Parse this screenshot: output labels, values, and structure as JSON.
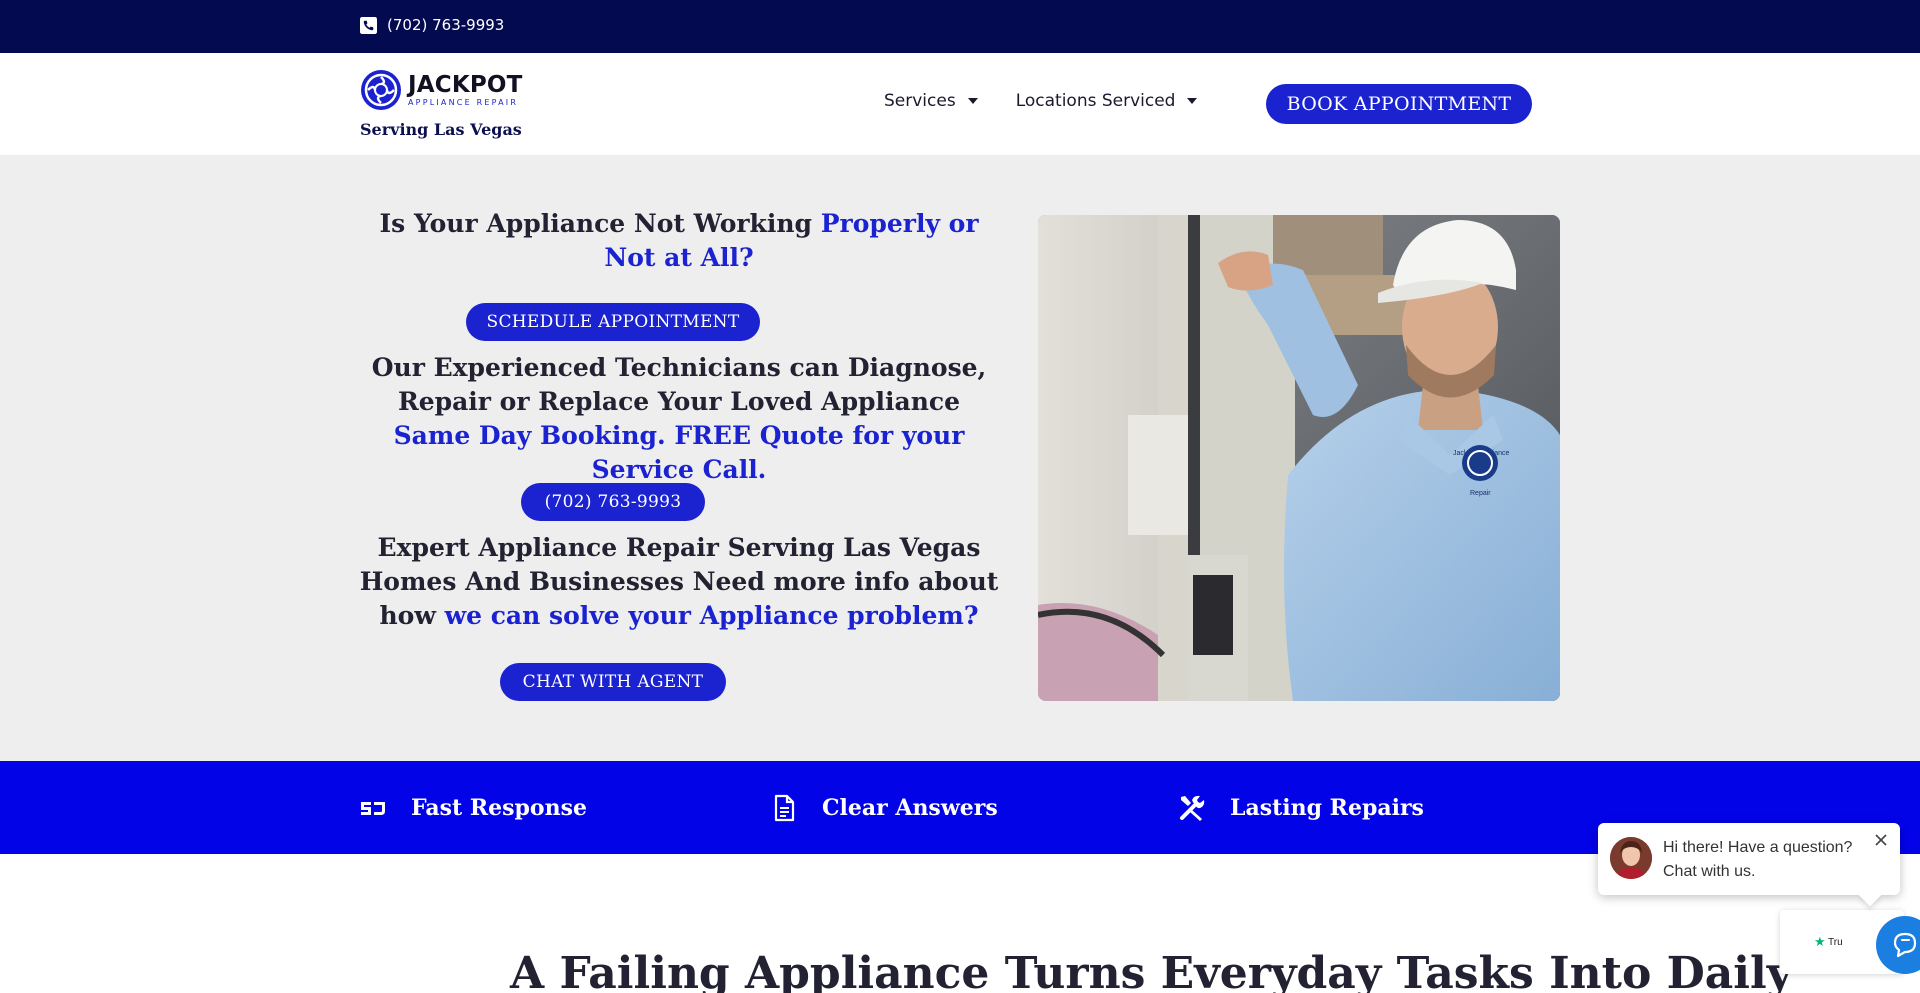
{
  "topbar": {
    "phone": "(702) 763-9993",
    "icon": "phone-square-icon"
  },
  "header": {
    "logo": {
      "brand": "JACKPOT",
      "sub": "APPLIANCE REPAIR",
      "icon": "jackpot-logo-icon"
    },
    "serving": "Serving Las Vegas",
    "nav": [
      {
        "label": "Services",
        "icon": "caret-down-icon"
      },
      {
        "label": "Locations Serviced",
        "icon": "caret-down-icon"
      }
    ],
    "book_button": "BOOK APPOINTMENT"
  },
  "hero": {
    "heading1": {
      "plain": "Is Your Appliance Not Working ",
      "highlight": "Properly or Not at All?"
    },
    "schedule_button": "SCHEDULE APPOINTMENT",
    "heading2": {
      "plain": "Our Experienced Technicians can Diagnose, Repair or Replace Your Loved Appliance ",
      "highlight": "Same Day Booking. FREE Quote for your Service Call."
    },
    "phone_button": "(702) 763-9993",
    "heading3": {
      "plain": "Expert Appliance Repair Serving Las Vegas Homes And Businesses Need more info about how ",
      "highlight": "we can solve your Appliance problem?"
    },
    "chat_button": "CHAT WITH AGENT",
    "photo_text": {
      "shirt_line1": "Jackpot Appliance",
      "shirt_line2": "Repair"
    }
  },
  "features": [
    {
      "label": "Fast Response",
      "icon": "fast-response-icon"
    },
    {
      "label": "Clear Answers",
      "icon": "document-icon"
    },
    {
      "label": "Lasting Repairs",
      "icon": "tools-icon"
    }
  ],
  "lower": {
    "heading": "A Failing Appliance Turns Everyday Tasks Into Daily"
  },
  "chat": {
    "message": "Hi there! Have a question? Chat with us.",
    "trust_label": "Tru",
    "fab_icon": "chat-icon"
  },
  "colors": {
    "topbar": "#030a4f",
    "accent": "#1b22d0",
    "features_bg": "#0303e8",
    "hero_bg": "#eeeeee",
    "chat_fab": "#1a7fe0"
  }
}
